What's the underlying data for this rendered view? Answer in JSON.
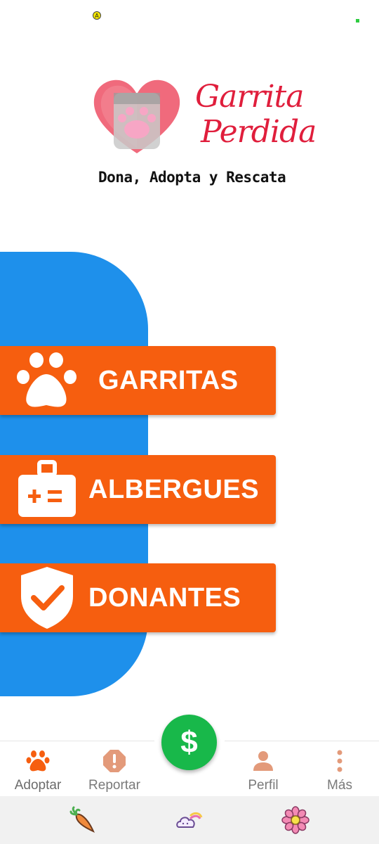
{
  "status": {
    "indicator": "A"
  },
  "logo": {
    "brand_line1": "Garrita",
    "brand_line2": "Perdida",
    "tagline": "Dona, Adopta y Rescata"
  },
  "menu": {
    "garritas_label": "GARRITAS",
    "albergues_label": "ALBERGUES",
    "donantes_label": "DONANTES"
  },
  "bottom_nav": {
    "adoptar": "Adoptar",
    "reportar": "Reportar",
    "donate_symbol": "$",
    "perfil": "Perfil",
    "mas": "Más"
  },
  "colors": {
    "accent_orange": "#f65e0f",
    "blue": "#1e90eb",
    "fab_green": "#18b84a",
    "brand_red": "#e01e3c"
  },
  "icons": {
    "garritas": "paw-icon",
    "albergues": "kit-icon",
    "donantes": "shield-check-icon",
    "adoptar": "paw-icon",
    "reportar": "alert-icon",
    "perfil": "person-icon",
    "mas": "more-vert-icon",
    "system": [
      "carrot-icon",
      "cloud-rainbow-icon",
      "flower-icon"
    ]
  }
}
